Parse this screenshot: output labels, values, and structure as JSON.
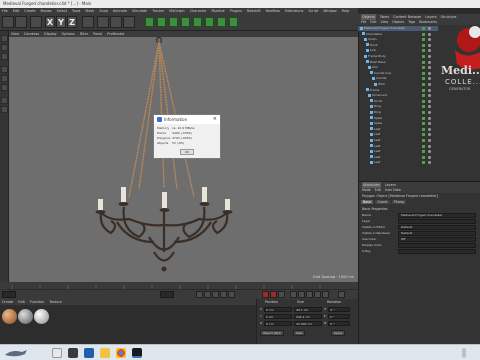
{
  "window": {
    "title": "Medieval Forged chandelier.c4d * [...] - Main"
  },
  "menubar": [
    "File",
    "Edit",
    "Create",
    "Modes",
    "Select",
    "Tools",
    "Mesh",
    "Snap",
    "Animate",
    "Simulate",
    "Tracker",
    "MoGraph",
    "Character",
    "Pipeline",
    "Plugins",
    "Redshift",
    "Realflow",
    "Extensions",
    "Script",
    "Window",
    "Help"
  ],
  "viewport": {
    "menu": [
      "View",
      "Cameras",
      "Display",
      "Options",
      "Filter",
      "Panel",
      "ProRender"
    ],
    "grid_spacing": "Grid Spacing : 1000 cm"
  },
  "dialog": {
    "title": "Information",
    "rows": [
      {
        "key": "Memory",
        "value": "ca. 10.9 MByte"
      },
      {
        "key": "Points",
        "value": "4494 (-0369)"
      },
      {
        "key": "Polygons",
        "value": "4793 (-0039)"
      },
      {
        "key": "Objects",
        "value": "53 (-65)"
      }
    ],
    "ok_label": "OK"
  },
  "materials": {
    "menu": [
      "Create",
      "Edit",
      "Function",
      "Texture"
    ]
  },
  "coords": {
    "headers": [
      "Position",
      "Size",
      "Rotation"
    ],
    "rows": [
      {
        "axis": "X",
        "pos": "0 cm",
        "size": "90.1 cm",
        "rot": "H",
        "rotval": "0 °"
      },
      {
        "axis": "Y",
        "pos": "0 cm",
        "size": "244.2 cm",
        "rot": "P",
        "rotval": "0 °"
      },
      {
        "axis": "Z",
        "pos": "0 cm",
        "size": "22.902 cm",
        "rot": "B",
        "rotval": "0 °"
      }
    ],
    "object_btn": "Object (Rel)",
    "size_btn": "Size",
    "apply_btn": "Apply"
  },
  "objects": {
    "tabs": [
      "Objects",
      "Takes",
      "Content Browser",
      "Layers",
      "Structure"
    ],
    "menu": [
      "File",
      "Edit",
      "View",
      "Objects",
      "Tags",
      "Bookmarks"
    ],
    "items": [
      "Medieval Forged chandelier",
      "Chandelier",
      "Chain",
      "Hook",
      "Link",
      "Frame Body",
      "Bowl Base",
      "Arm",
      "Candle Cup",
      "Candle",
      "Wick",
      "Frame",
      "Ornament",
      "Scroll",
      "Ring",
      "Ring",
      "Spike",
      "Spike",
      "Leaf",
      "Leaf",
      "Leaf",
      "Leaf",
      "Leaf",
      "Leaf",
      "Leaf"
    ],
    "branding_text": "Medi...",
    "branding_sub": "COLLE...",
    "branding_small": "GENERATOR"
  },
  "attributes": {
    "tabs": [
      "Attributes",
      "Layers"
    ],
    "menu": [
      "Mode",
      "Edit",
      "User Data"
    ],
    "title": "Polygon Object [Medieval Forged chandelier]",
    "subtabs": [
      "Basic",
      "Coord.",
      "Phong"
    ],
    "section": "Basic Properties",
    "props": [
      {
        "key": "Name",
        "value": "Medieval Forged chandelier"
      },
      {
        "key": "Layer",
        "value": ""
      },
      {
        "key": "Visible in Editor",
        "value": "Default"
      },
      {
        "key": "Visible in Renderer",
        "value": "Default"
      },
      {
        "key": "Use Color",
        "value": "Off"
      },
      {
        "key": "Display Color",
        "value": ""
      },
      {
        "key": "X-Ray",
        "value": ""
      }
    ]
  },
  "colors": {
    "accent": "#3a6fd0",
    "viewport_bg": "#6e6e6e",
    "rope": "#b8875a"
  }
}
